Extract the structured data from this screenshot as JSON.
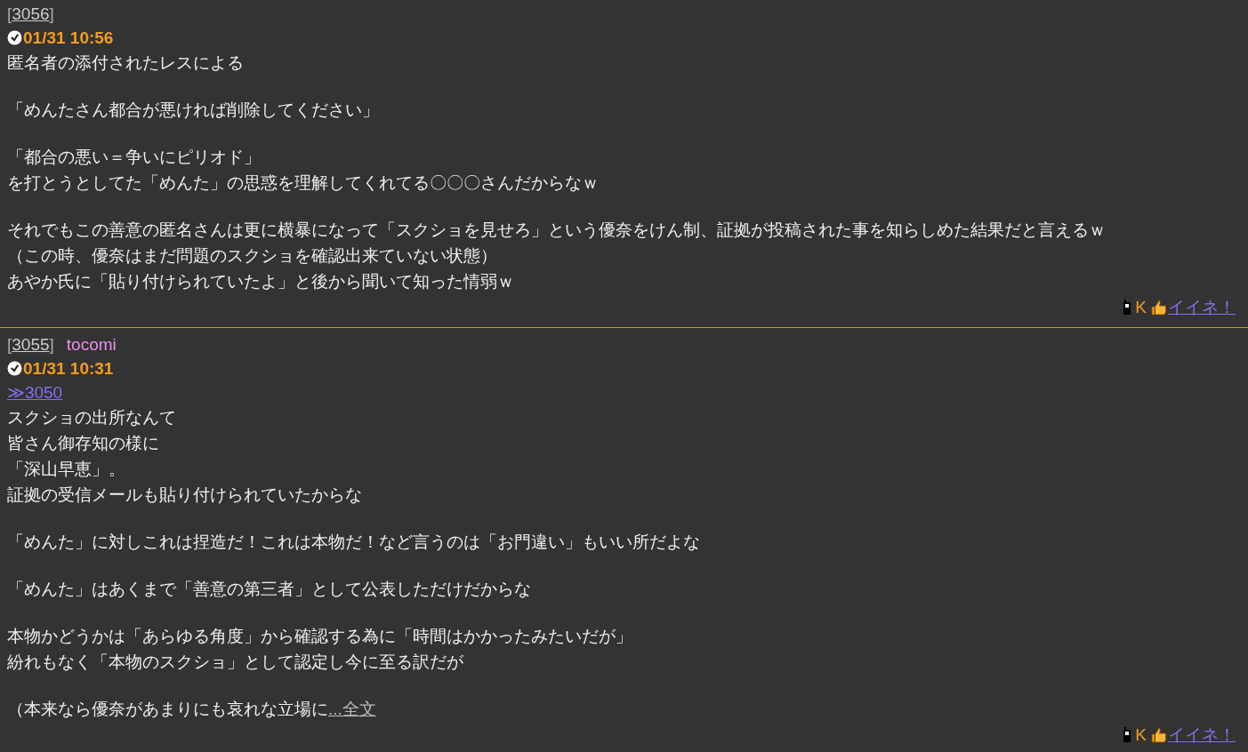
{
  "posts": [
    {
      "number_open": "[",
      "number": "3056",
      "number_close": "]",
      "date": "01/31 10:56",
      "body": [
        {
          "lines": [
            "匿名者の添付されたレスによる"
          ]
        },
        {
          "lines": [
            "「めんたさん都合が悪ければ削除してください」"
          ]
        },
        {
          "lines": [
            "「都合の悪い＝争いにピリオド」",
            "を打とうとしてた「めんた」の思惑を理解してくれてる〇〇〇さんだからなｗ"
          ]
        },
        {
          "lines": [
            "それでもこの善意の匿名さんは更に横暴になって「スクショを見せろ」という優奈をけん制、証拠が投稿された事を知らしめた結果だと言えるｗ",
            "（この時、優奈はまだ問題のスクショを確認出来ていない状態）",
            "あやか氏に「貼り付けられていたよ」と後から聞いて知った情弱ｗ"
          ]
        }
      ],
      "footer_label": "K",
      "like": "イイネ！"
    },
    {
      "number_open": "[",
      "number": "3055",
      "number_close": "]",
      "name": "tocomi",
      "date": "01/31 10:31",
      "reply_to": "≫3050",
      "body": [
        {
          "lines": [
            "スクショの出所なんて",
            "皆さん御存知の様に",
            "「深山早恵」。",
            "証拠の受信メールも貼り付けられていたからな"
          ]
        },
        {
          "lines": [
            "「めんた」に対しこれは捏造だ！これは本物だ！など言うのは「お門違い」もいい所だよな"
          ]
        },
        {
          "lines": [
            "「めんた」はあくまで「善意の第三者」として公表しただけだからな"
          ]
        },
        {
          "lines": [
            "本物かどうかは「あらゆる角度」から確認する為に「時間はかかったみたいだが」",
            "紛れもなく「本物のスクショ」として認定し今に至る訳だが"
          ]
        },
        {
          "lines": [
            "（本来なら優奈があまりにも哀れな立場に"
          ]
        }
      ],
      "more": "...全文",
      "footer_label": "K",
      "like": "イイネ！"
    }
  ]
}
